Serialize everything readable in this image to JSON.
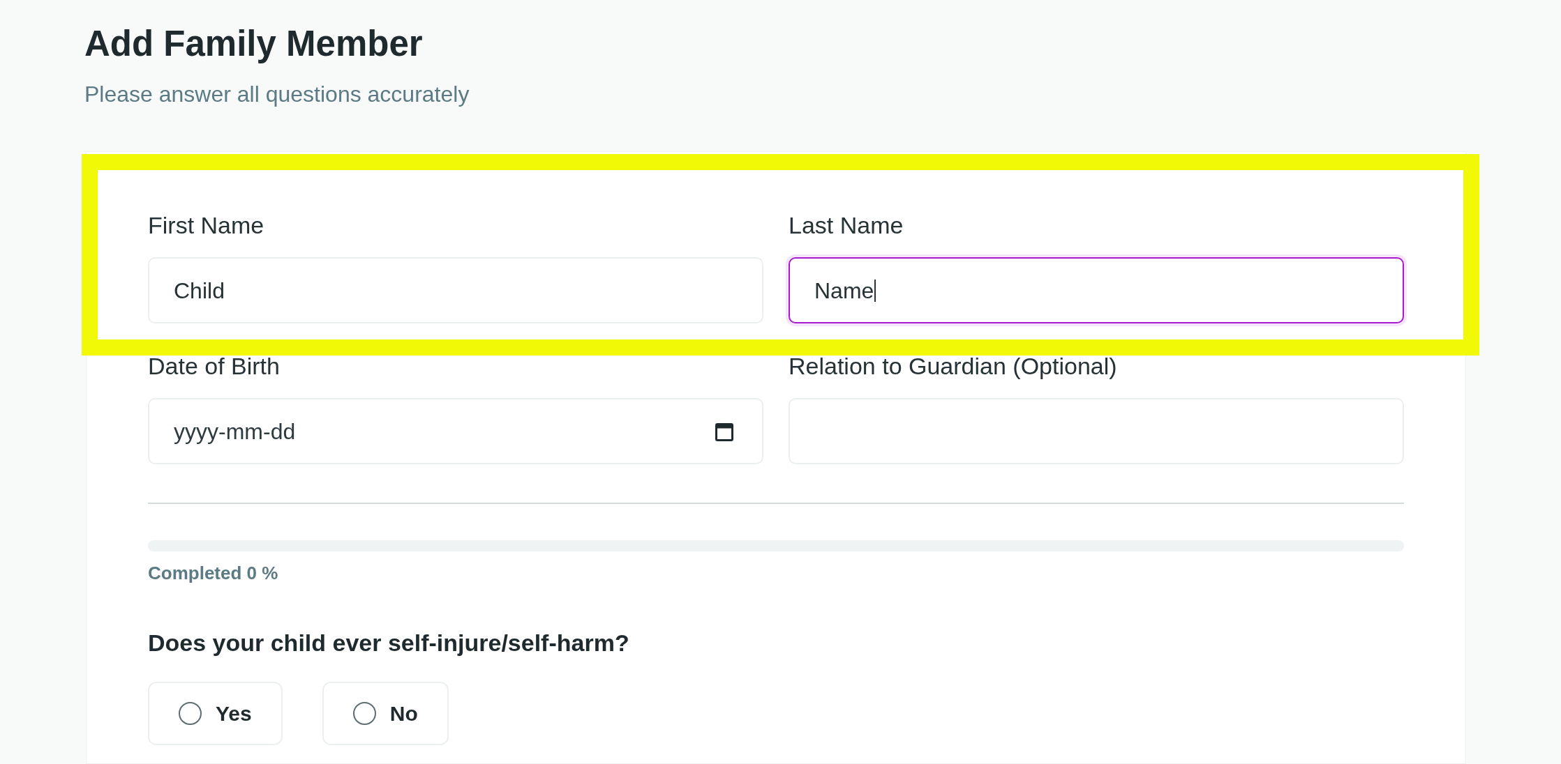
{
  "header": {
    "title": "Add Family Member",
    "subtitle": "Please answer all questions accurately"
  },
  "form": {
    "field_rows": [
      {
        "highlighted": true,
        "fields": [
          {
            "kind": "text",
            "label": "First Name",
            "value": "Child",
            "focused": false
          },
          {
            "kind": "text",
            "label": "Last Name",
            "value": "Name",
            "focused": true
          }
        ]
      },
      {
        "highlighted": false,
        "fields": [
          {
            "kind": "date",
            "label": "Date of Birth",
            "placeholder": "yyyy-mm-dd",
            "focused": false
          },
          {
            "kind": "text",
            "label": "Relation to Guardian (Optional)",
            "focused": false
          }
        ]
      }
    ],
    "progress": {
      "level": 0,
      "reading": "Completed 0 %"
    },
    "questions": [
      {
        "text": "Does your child ever self-injure/self-harm?",
        "options": [
          {
            "label": "Yes",
            "selected": false
          },
          {
            "label": "No",
            "selected": false
          }
        ]
      }
    ]
  }
}
